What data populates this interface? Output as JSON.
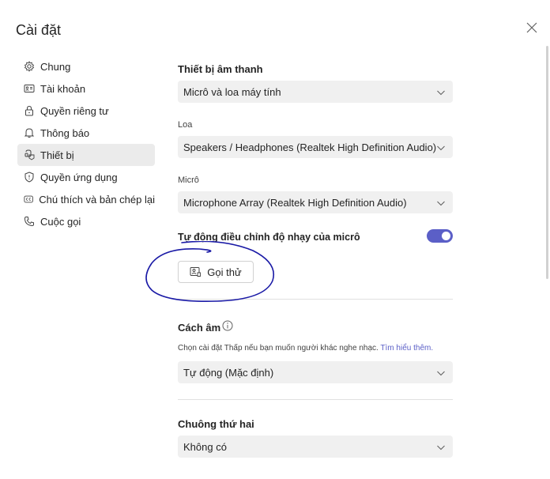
{
  "header": {
    "title": "Cài đặt"
  },
  "sidebar": {
    "items": [
      {
        "label": "Chung",
        "icon": "gear-icon"
      },
      {
        "label": "Tài khoản",
        "icon": "id-card-icon"
      },
      {
        "label": "Quyền riêng tư",
        "icon": "lock-icon"
      },
      {
        "label": "Thông báo",
        "icon": "bell-icon"
      },
      {
        "label": "Thiết bị",
        "icon": "device-icon",
        "selected": true
      },
      {
        "label": "Quyền ứng dụng",
        "icon": "shield-icon"
      },
      {
        "label": "Chú thích và bản chép lại",
        "icon": "cc-icon"
      },
      {
        "label": "Cuộc gọi",
        "icon": "phone-icon"
      }
    ]
  },
  "devices": {
    "audio_title": "Thiết bị âm thanh",
    "audio_value": "Micrô và loa máy tính",
    "speaker_label": "Loa",
    "speaker_value": "Speakers / Headphones (Realtek High Definition Audio)",
    "mic_label": "Micrô",
    "mic_value": "Microphone Array (Realtek High Definition Audio)",
    "auto_adjust_label": "Tự động điều chỉnh độ nhạy của micrô",
    "auto_adjust_on": true,
    "test_call_label": "Gọi thử"
  },
  "noise": {
    "title": "Cách âm",
    "hint": "Chọn cài đặt Thấp nếu bạn muốn người khác nghe nhạc.",
    "learn_more": "Tìm hiểu thêm.",
    "value": "Tự động (Mặc định)"
  },
  "ring": {
    "title": "Chuông thứ hai",
    "value": "Không có"
  },
  "colors": {
    "accent": "#5b5fc7",
    "annotation": "#1a1aa6"
  }
}
